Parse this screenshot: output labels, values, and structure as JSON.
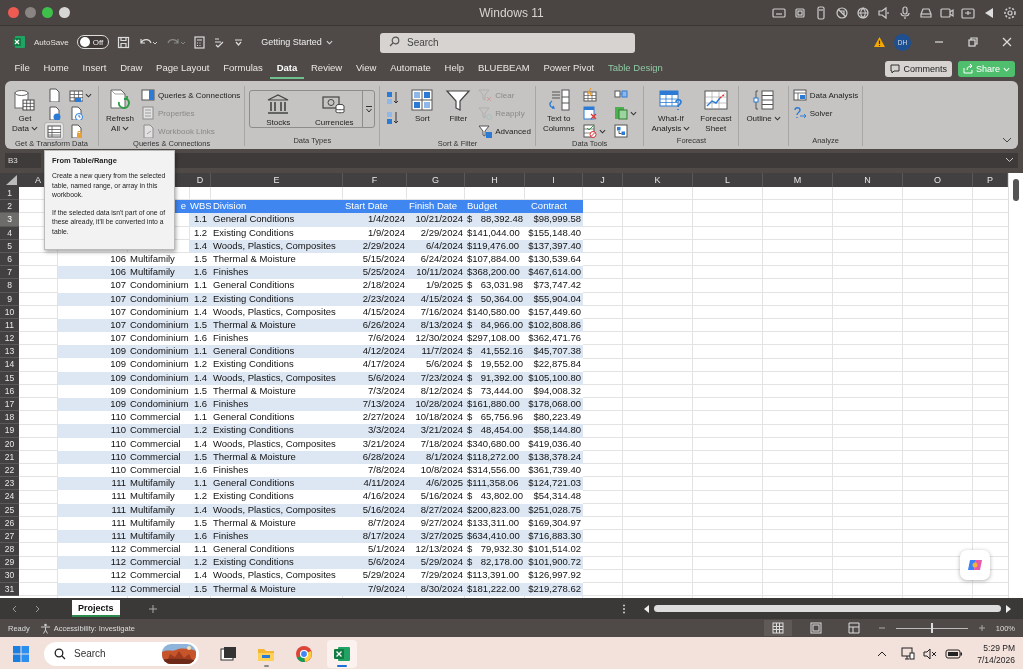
{
  "mac_window": {
    "title": "Windows 11"
  },
  "title_bar": {
    "autosave_label": "AutoSave",
    "autosave_toggle": {
      "label": "Off",
      "on": false
    },
    "document_title": "Getting Started",
    "search": {
      "placeholder": "Search"
    },
    "avatar": "DH"
  },
  "ribbon_tabs": [
    {
      "label": "File",
      "selected": false,
      "kind": "normal"
    },
    {
      "label": "Home",
      "selected": false,
      "kind": "normal"
    },
    {
      "label": "Insert",
      "selected": false,
      "kind": "normal"
    },
    {
      "label": "Draw",
      "selected": false,
      "kind": "normal"
    },
    {
      "label": "Page Layout",
      "selected": false,
      "kind": "normal"
    },
    {
      "label": "Formulas",
      "selected": false,
      "kind": "normal"
    },
    {
      "label": "Data",
      "selected": true,
      "kind": "normal"
    },
    {
      "label": "Review",
      "selected": false,
      "kind": "normal"
    },
    {
      "label": "View",
      "selected": false,
      "kind": "normal"
    },
    {
      "label": "Automate",
      "selected": false,
      "kind": "normal"
    },
    {
      "label": "Help",
      "selected": false,
      "kind": "normal"
    },
    {
      "label": "BLUEBEAM",
      "selected": false,
      "kind": "normal"
    },
    {
      "label": "Power Pivot",
      "selected": false,
      "kind": "normal"
    },
    {
      "label": "Table Design",
      "selected": false,
      "kind": "contextual"
    }
  ],
  "comments_button": "Comments",
  "share_button": "Share",
  "ribbon_groups": [
    {
      "label": "Get & Transform Data",
      "items": [
        {
          "kind": "large",
          "lines": [
            "Get",
            "Data"
          ],
          "dropdown": true
        },
        {
          "kind": "icon_grid",
          "icons": [
            {
              "dropdown": false,
              "hovered": false
            },
            {
              "dropdown": true,
              "hovered": false
            },
            {
              "dropdown": false,
              "hovered": false
            },
            {
              "dropdown": false,
              "hovered": false
            },
            {
              "dropdown": false,
              "hovered": true
            },
            {
              "dropdown": false,
              "hovered": false
            }
          ]
        }
      ]
    },
    {
      "label": "Queries & Connections",
      "items": [
        {
          "kind": "large",
          "lines": [
            "Refresh",
            "All"
          ],
          "dropdown": true
        },
        {
          "kind": "list",
          "entries": [
            {
              "label": "Queries & Connections",
              "disabled": false
            },
            {
              "label": "Properties",
              "disabled": true
            },
            {
              "label": "Workbook Links",
              "disabled": true
            }
          ]
        }
      ]
    },
    {
      "label": "Data Types",
      "items": [
        {
          "kind": "gallery",
          "entries": [
            {
              "label": "Stocks"
            },
            {
              "label": "Currencies"
            }
          ]
        }
      ]
    },
    {
      "label": "Sort & Filter",
      "items": [
        {
          "kind": "icon_stack",
          "icons": [
            {
              "dropdown": false,
              "hovered": false
            },
            {
              "dropdown": false,
              "hovered": false
            }
          ]
        },
        {
          "kind": "large",
          "lines": [
            "Sort"
          ],
          "dropdown": false
        },
        {
          "kind": "large",
          "lines": [
            "Filter"
          ],
          "dropdown": false
        },
        {
          "kind": "list",
          "entries": [
            {
              "label": "Clear",
              "disabled": true
            },
            {
              "label": "Reapply",
              "disabled": true
            },
            {
              "label": "Advanced",
              "disabled": false
            }
          ]
        }
      ]
    },
    {
      "label": "Data Tools",
      "items": [
        {
          "kind": "large",
          "lines": [
            "Text to",
            "Columns"
          ],
          "dropdown": false
        },
        {
          "kind": "icon_grid",
          "icons": [
            {
              "dropdown": false,
              "hovered": false
            },
            {
              "dropdown": false,
              "hovered": false
            },
            {
              "dropdown": false,
              "hovered": false
            },
            {
              "dropdown": true,
              "hovered": false
            },
            {
              "dropdown": true,
              "hovered": false
            },
            {
              "dropdown": false,
              "hovered": false
            }
          ]
        }
      ]
    },
    {
      "label": "Forecast",
      "items": [
        {
          "kind": "large",
          "lines": [
            "What-If",
            "Analysis"
          ],
          "dropdown": true
        },
        {
          "kind": "large",
          "lines": [
            "Forecast",
            "Sheet"
          ],
          "dropdown": false
        }
      ]
    },
    {
      "items": [
        {
          "kind": "large",
          "lines": [
            "Outline"
          ],
          "dropdown": true
        }
      ]
    },
    {
      "label": "Analyze",
      "items": [
        {
          "kind": "list",
          "entries": [
            {
              "label": "Data Analysis",
              "disabled": false
            },
            {
              "label": "Solver",
              "disabled": false
            }
          ]
        }
      ]
    }
  ],
  "name_box": "B3",
  "tooltip": {
    "title": "From Table/Range",
    "paragraphs": [
      "Create a new query from the selected table, named range, or array in this workbook.",
      "If the selected data isn't part of one of these already, it'll be converted into a table."
    ]
  },
  "columns": [
    {
      "letter": "A"
    },
    {},
    {},
    {
      "letter": "D"
    },
    {
      "letter": "E"
    },
    {
      "letter": "F"
    },
    {
      "letter": "G"
    },
    {
      "letter": "H"
    },
    {
      "letter": "I"
    },
    {
      "letter": "J"
    },
    {
      "letter": "K"
    },
    {
      "letter": "L"
    },
    {
      "letter": "M"
    },
    {
      "letter": "N"
    },
    {
      "letter": "O"
    },
    {
      "letter": "P"
    }
  ],
  "rows": [
    {
      "number": "1",
      "selected": false,
      "kind": "blank"
    },
    {
      "number": "2",
      "selected": false,
      "kind": "header",
      "cells": {
        "C": "e",
        "D": "WBS",
        "E": "Division",
        "F": "Start Date",
        "G": "Finish Date",
        "H": "Budget",
        "I": "Contract"
      }
    },
    {
      "number": "3",
      "selected": true,
      "kind": "data",
      "cells": {
        "D": "1.1",
        "E": "General Conditions",
        "F": "1/4/2024",
        "G": "10/21/2024",
        "H": "$ 88,392.48",
        "I": "$98,999.58"
      }
    },
    {
      "number": "4",
      "selected": false,
      "kind": "data",
      "cells": {
        "D": "1.2",
        "E": "Existing Conditions",
        "F": "1/9/2024",
        "G": "2/29/2024",
        "H": "$141,044.00",
        "I": "$155,148.40"
      }
    },
    {
      "number": "5",
      "selected": false,
      "kind": "data",
      "cells": {
        "D": "1.4",
        "E": "Woods, Plastics, Composites",
        "F": "2/29/2024",
        "G": "6/4/2024",
        "H": "$119,476.00",
        "I": "$137,397.40"
      }
    },
    {
      "number": "6",
      "selected": false,
      "kind": "data",
      "cells": {
        "B": "106",
        "C": "Multifamily",
        "D": "1.5",
        "E": "Thermal & Moisture",
        "F": "5/15/2024",
        "G": "6/24/2024",
        "H": "$107,884.00",
        "I": "$130,539.64"
      }
    },
    {
      "number": "7",
      "selected": false,
      "kind": "data",
      "cells": {
        "B": "106",
        "C": "Multifamily",
        "D": "1.6",
        "E": "Finishes",
        "F": "5/25/2024",
        "G": "10/11/2024",
        "H": "$368,200.00",
        "I": "$467,614.00"
      }
    },
    {
      "number": "8",
      "selected": false,
      "kind": "data",
      "cells": {
        "B": "107",
        "C": "Condominium",
        "D": "1.1",
        "E": "General Conditions",
        "F": "2/18/2024",
        "G": "1/9/2025",
        "H": "$ 63,031.98",
        "I": "$73,747.42"
      }
    },
    {
      "number": "9",
      "selected": false,
      "kind": "data",
      "cells": {
        "B": "107",
        "C": "Condominium",
        "D": "1.2",
        "E": "Existing Conditions",
        "F": "2/23/2024",
        "G": "4/15/2024",
        "H": "$ 50,364.00",
        "I": "$55,904.04"
      }
    },
    {
      "number": "10",
      "selected": false,
      "kind": "data",
      "cells": {
        "B": "107",
        "C": "Condominium",
        "D": "1.4",
        "E": "Woods, Plastics, Composites",
        "F": "4/15/2024",
        "G": "7/16/2024",
        "H": "$140,580.00",
        "I": "$157,449.60"
      }
    },
    {
      "number": "11",
      "selected": false,
      "kind": "data",
      "cells": {
        "B": "107",
        "C": "Condominium",
        "D": "1.5",
        "E": "Thermal & Moisture",
        "F": "6/26/2024",
        "G": "8/13/2024",
        "H": "$ 84,966.00",
        "I": "$102,808.86"
      }
    },
    {
      "number": "12",
      "selected": false,
      "kind": "data",
      "cells": {
        "B": "107",
        "C": "Condominium",
        "D": "1.6",
        "E": "Finishes",
        "F": "7/6/2024",
        "G": "12/30/2024",
        "H": "$297,108.00",
        "I": "$362,471.76"
      }
    },
    {
      "number": "13",
      "selected": false,
      "kind": "data",
      "cells": {
        "B": "109",
        "C": "Condominium",
        "D": "1.1",
        "E": "General Conditions",
        "F": "4/12/2024",
        "G": "11/7/2024",
        "H": "$ 41,552.16",
        "I": "$45,707.38"
      }
    },
    {
      "number": "14",
      "selected": false,
      "kind": "data",
      "cells": {
        "B": "109",
        "C": "Condominium",
        "D": "1.2",
        "E": "Existing Conditions",
        "F": "4/17/2024",
        "G": "5/6/2024",
        "H": "$ 19,552.00",
        "I": "$22,875.84"
      }
    },
    {
      "number": "15",
      "selected": false,
      "kind": "data",
      "cells": {
        "B": "109",
        "C": "Condominium",
        "D": "1.4",
        "E": "Woods, Plastics, Composites",
        "F": "5/6/2024",
        "G": "7/23/2024",
        "H": "$ 91,392.00",
        "I": "$105,100.80"
      }
    },
    {
      "number": "16",
      "selected": false,
      "kind": "data",
      "cells": {
        "B": "109",
        "C": "Condominium",
        "D": "1.5",
        "E": "Thermal & Moisture",
        "F": "7/3/2024",
        "G": "8/12/2024",
        "H": "$ 73,444.00",
        "I": "$94,008.32"
      }
    },
    {
      "number": "17",
      "selected": false,
      "kind": "data",
      "cells": {
        "B": "109",
        "C": "Condominium",
        "D": "1.6",
        "E": "Finishes",
        "F": "7/13/2024",
        "G": "10/28/2024",
        "H": "$161,880.00",
        "I": "$178,068.00"
      }
    },
    {
      "number": "18",
      "selected": false,
      "kind": "data",
      "cells": {
        "B": "110",
        "C": "Commercial",
        "D": "1.1",
        "E": "General Conditions",
        "F": "2/27/2024",
        "G": "10/18/2024",
        "H": "$ 65,756.96",
        "I": "$80,223.49"
      }
    },
    {
      "number": "19",
      "selected": false,
      "kind": "data",
      "cells": {
        "B": "110",
        "C": "Commercial",
        "D": "1.2",
        "E": "Existing Conditions",
        "F": "3/3/2024",
        "G": "3/21/2024",
        "H": "$ 48,454.00",
        "I": "$58,144.80"
      }
    },
    {
      "number": "20",
      "selected": false,
      "kind": "data",
      "cells": {
        "B": "110",
        "C": "Commercial",
        "D": "1.4",
        "E": "Woods, Plastics, Composites",
        "F": "3/21/2024",
        "G": "7/18/2024",
        "H": "$340,680.00",
        "I": "$419,036.40"
      }
    },
    {
      "number": "21",
      "selected": false,
      "kind": "data",
      "cells": {
        "B": "110",
        "C": "Commercial",
        "D": "1.5",
        "E": "Thermal & Moisture",
        "F": "6/28/2024",
        "G": "8/1/2024",
        "H": "$118,272.00",
        "I": "$138,378.24"
      }
    },
    {
      "number": "22",
      "selected": false,
      "kind": "data",
      "cells": {
        "B": "110",
        "C": "Commercial",
        "D": "1.6",
        "E": "Finishes",
        "F": "7/8/2024",
        "G": "10/8/2024",
        "H": "$314,556.00",
        "I": "$361,739.40"
      }
    },
    {
      "number": "23",
      "selected": false,
      "kind": "data",
      "cells": {
        "B": "111",
        "C": "Multifamily",
        "D": "1.1",
        "E": "General Conditions",
        "F": "4/11/2024",
        "G": "4/6/2025",
        "H": "$111,358.06",
        "I": "$124,721.03"
      }
    },
    {
      "number": "24",
      "selected": false,
      "kind": "data",
      "cells": {
        "B": "111",
        "C": "Multifamily",
        "D": "1.2",
        "E": "Existing Conditions",
        "F": "4/16/2024",
        "G": "5/16/2024",
        "H": "$ 43,802.00",
        "I": "$54,314.48"
      }
    },
    {
      "number": "25",
      "selected": false,
      "kind": "data",
      "cells": {
        "B": "111",
        "C": "Multifamily",
        "D": "1.4",
        "E": "Woods, Plastics, Composites",
        "F": "5/16/2024",
        "G": "8/27/2024",
        "H": "$200,823.00",
        "I": "$251,028.75"
      }
    },
    {
      "number": "26",
      "selected": false,
      "kind": "data",
      "cells": {
        "B": "111",
        "C": "Multifamily",
        "D": "1.5",
        "E": "Thermal & Moisture",
        "F": "8/7/2024",
        "G": "9/27/2024",
        "H": "$133,311.00",
        "I": "$169,304.97"
      }
    },
    {
      "number": "27",
      "selected": false,
      "kind": "data",
      "cells": {
        "B": "111",
        "C": "Multifamily",
        "D": "1.6",
        "E": "Finishes",
        "F": "8/17/2024",
        "G": "3/27/2025",
        "H": "$634,410.00",
        "I": "$716,883.30"
      }
    },
    {
      "number": "28",
      "selected": false,
      "kind": "data",
      "cells": {
        "B": "112",
        "C": "Commercial",
        "D": "1.1",
        "E": "General Conditions",
        "F": "5/1/2024",
        "G": "12/13/2024",
        "H": "$ 79,932.30",
        "I": "$101,514.02"
      }
    },
    {
      "number": "29",
      "selected": false,
      "kind": "data",
      "cells": {
        "B": "112",
        "C": "Commercial",
        "D": "1.2",
        "E": "Existing Conditions",
        "F": "5/6/2024",
        "G": "5/29/2024",
        "H": "$ 82,178.00",
        "I": "$101,900.72"
      }
    },
    {
      "number": "30",
      "selected": false,
      "kind": "data",
      "cells": {
        "B": "112",
        "C": "Commercial",
        "D": "1.4",
        "E": "Woods, Plastics, Composites",
        "F": "5/29/2024",
        "G": "7/29/2024",
        "H": "$113,391.00",
        "I": "$126,997.92"
      }
    },
    {
      "number": "31",
      "selected": false,
      "kind": "data",
      "cells": {
        "B": "112",
        "C": "Commercial",
        "D": "1.5",
        "E": "Thermal & Moisture",
        "F": "7/9/2024",
        "G": "8/30/2024",
        "H": "$181,222.00",
        "I": "$219,278.62"
      }
    }
  ],
  "sheet_tabs": [
    {
      "label": "Projects",
      "selected": true
    }
  ],
  "status_bar": {
    "status": "Ready",
    "accessibility": "Accessibility: Investigate",
    "views": [
      {
        "kind": "normal",
        "selected": true
      },
      {
        "kind": "page_layout",
        "selected": false
      },
      {
        "kind": "page_break",
        "selected": false
      }
    ],
    "zoom": {
      "level": 0.5,
      "reading": "100%"
    }
  },
  "taskbar": {
    "search": {
      "placeholder": "Search"
    },
    "apps": [
      {
        "kind": "task_view",
        "running": false,
        "active": false
      },
      {
        "kind": "explorer",
        "running": true,
        "active": false
      },
      {
        "kind": "browser",
        "running": false,
        "active": false
      },
      {
        "kind": "excel",
        "running": true,
        "active": true
      }
    ],
    "time": "5:29 PM",
    "date": "7/14/2026"
  }
}
